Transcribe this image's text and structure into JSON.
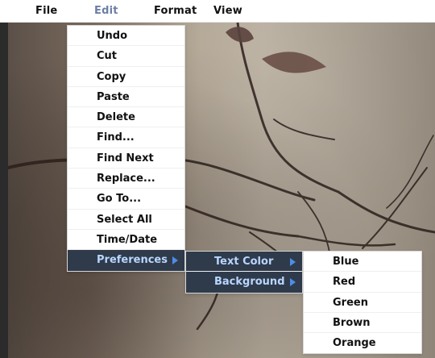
{
  "menubar": {
    "items": [
      {
        "label": "File"
      },
      {
        "label": "Edit",
        "active": true
      },
      {
        "label": "Format"
      },
      {
        "label": "View"
      }
    ],
    "active_color": "#6b7fa6"
  },
  "menus": {
    "edit": {
      "items": [
        {
          "label": "Undo"
        },
        {
          "label": "Cut"
        },
        {
          "label": "Copy"
        },
        {
          "label": "Paste"
        },
        {
          "label": "Delete"
        },
        {
          "label": "Find..."
        },
        {
          "label": "Find Next"
        },
        {
          "label": "Replace..."
        },
        {
          "label": "Go To..."
        },
        {
          "label": "Select All"
        },
        {
          "label": "Time/Date"
        },
        {
          "label": "Preferences",
          "has_submenu": true,
          "highlighted": true
        }
      ]
    },
    "preferences": {
      "items": [
        {
          "label": "Text Color",
          "has_submenu": true,
          "highlighted": true
        },
        {
          "label": "Background",
          "has_submenu": true
        }
      ]
    },
    "text_color": {
      "items": [
        {
          "label": "Blue"
        },
        {
          "label": "Red"
        },
        {
          "label": "Green"
        },
        {
          "label": "Brown"
        },
        {
          "label": "Orange"
        }
      ]
    }
  },
  "colors": {
    "menu_highlight_bg": "#2f3b4b",
    "menu_highlight_text": "#b9d6ff",
    "submenu_arrow": "#4e8ce6"
  },
  "icons": {
    "submenu_arrow": "chevron-right-icon"
  }
}
